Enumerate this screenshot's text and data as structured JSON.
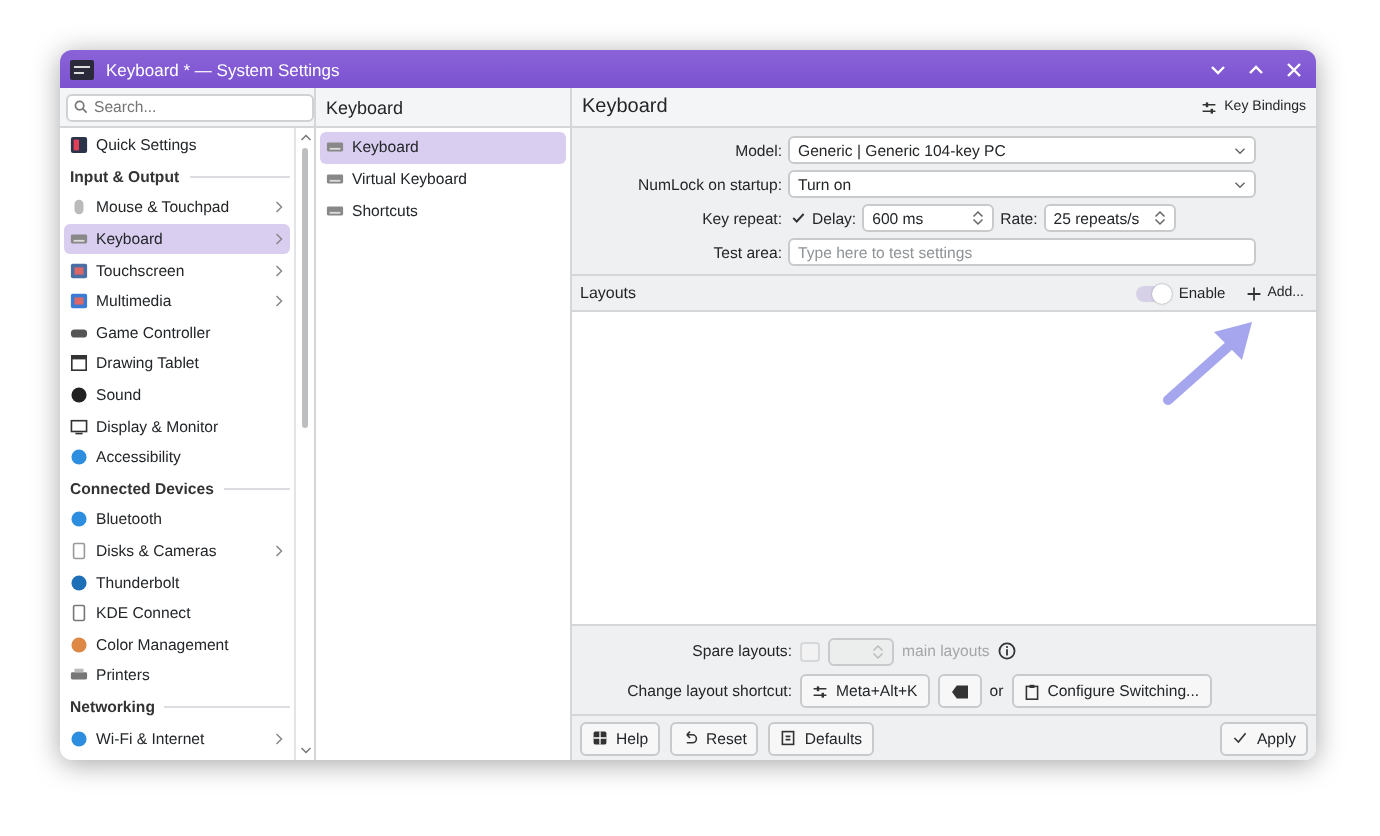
{
  "window": {
    "title": "Keyboard * — System Settings"
  },
  "sidebar": {
    "search": {
      "placeholder": "Search..."
    },
    "items": [
      {
        "kind": "item",
        "label": "Quick Settings",
        "selected": false,
        "has_children": false
      },
      {
        "kind": "header",
        "label": "Input & Output"
      },
      {
        "kind": "item",
        "label": "Mouse & Touchpad",
        "selected": false,
        "has_children": true
      },
      {
        "kind": "item",
        "label": "Keyboard",
        "selected": true,
        "has_children": true
      },
      {
        "kind": "item",
        "label": "Touchscreen",
        "selected": false,
        "has_children": true
      },
      {
        "kind": "item",
        "label": "Multimedia",
        "selected": false,
        "has_children": true
      },
      {
        "kind": "item",
        "label": "Game Controller",
        "selected": false,
        "has_children": false
      },
      {
        "kind": "item",
        "label": "Drawing Tablet",
        "selected": false,
        "has_children": false
      },
      {
        "kind": "item",
        "label": "Sound",
        "selected": false,
        "has_children": false
      },
      {
        "kind": "item",
        "label": "Display & Monitor",
        "selected": false,
        "has_children": false
      },
      {
        "kind": "item",
        "label": "Accessibility",
        "selected": false,
        "has_children": false
      },
      {
        "kind": "header",
        "label": "Connected Devices"
      },
      {
        "kind": "item",
        "label": "Bluetooth",
        "selected": false,
        "has_children": false
      },
      {
        "kind": "item",
        "label": "Disks & Cameras",
        "selected": false,
        "has_children": true
      },
      {
        "kind": "item",
        "label": "Thunderbolt",
        "selected": false,
        "has_children": false
      },
      {
        "kind": "item",
        "label": "KDE Connect",
        "selected": false,
        "has_children": false
      },
      {
        "kind": "item",
        "label": "Color Management",
        "selected": false,
        "has_children": false
      },
      {
        "kind": "item",
        "label": "Printers",
        "selected": false,
        "has_children": false
      },
      {
        "kind": "header",
        "label": "Networking"
      },
      {
        "kind": "item",
        "label": "Wi-Fi & Internet",
        "selected": false,
        "has_children": true
      }
    ]
  },
  "subpanel": {
    "title": "Keyboard",
    "items": [
      {
        "label": "Keyboard",
        "selected": true
      },
      {
        "label": "Virtual Keyboard",
        "selected": false
      },
      {
        "label": "Shortcuts",
        "selected": false
      }
    ]
  },
  "main": {
    "title": "Keyboard",
    "key_bindings_button": "Key Bindings",
    "model": {
      "label": "Model:",
      "value": "Generic | Generic 104-key PC"
    },
    "numlock": {
      "label": "NumLock on startup:",
      "value": "Turn on"
    },
    "key_repeat": {
      "label": "Key repeat:",
      "checked": true,
      "delay_label": "Delay:",
      "delay_value": "600 ms",
      "rate_label": "Rate:",
      "rate_value": "25 repeats/s"
    },
    "test_area": {
      "label": "Test area:",
      "placeholder": "Type here to test settings"
    },
    "layouts": {
      "title": "Layouts",
      "enable_label": "Enable",
      "enable_on": true,
      "add_button": "Add..."
    },
    "spare_layouts": {
      "label": "Spare layouts:",
      "checked": false,
      "suffix": "main layouts"
    },
    "change_shortcut": {
      "label": "Change layout shortcut:",
      "shortcut": "Meta+Alt+K",
      "or": "or",
      "configure_button": "Configure Switching..."
    }
  },
  "footer": {
    "help": "Help",
    "reset": "Reset",
    "defaults": "Defaults",
    "apply": "Apply"
  }
}
